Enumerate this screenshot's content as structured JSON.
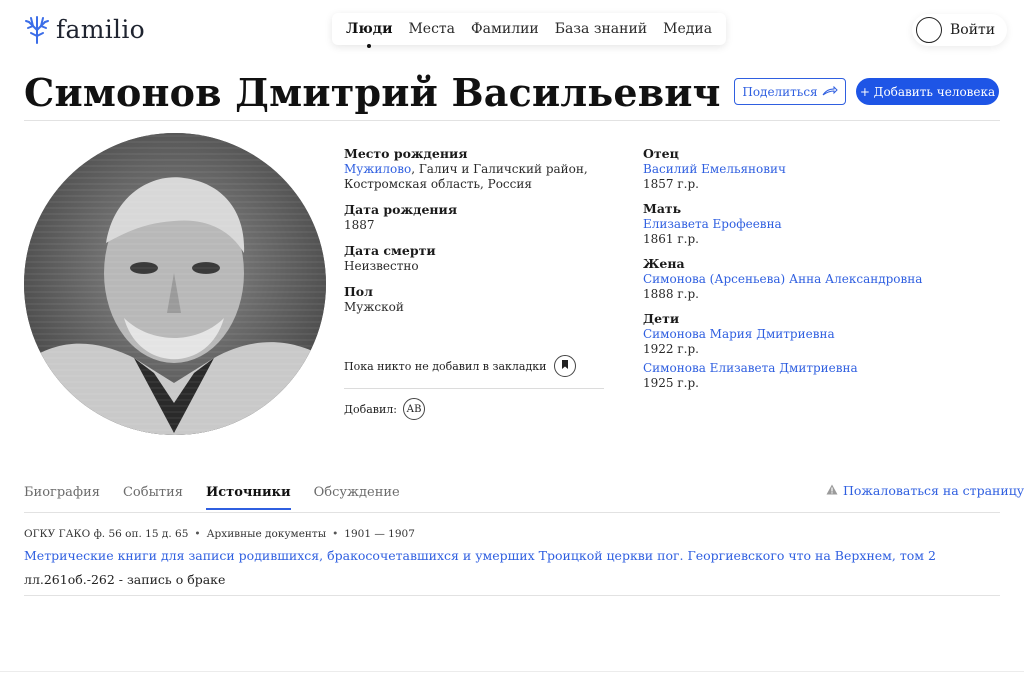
{
  "header": {
    "logo_text": "familio",
    "nav": [
      {
        "label": "Люди",
        "active": true
      },
      {
        "label": "Места"
      },
      {
        "label": "Фамилии"
      },
      {
        "label": "База знаний"
      },
      {
        "label": "Медиа"
      }
    ],
    "login_label": "Войти"
  },
  "person": {
    "name": "Симонов Дмитрий Васильевич",
    "share_label": "Поделиться",
    "add_label": "+ Добавить человека",
    "birth_place_label": "Место рождения",
    "birth_place_link": "Мужилово",
    "birth_place_rest": ", Галич и Галичский район, Костромская область, Россия",
    "birth_date_label": "Дата рождения",
    "birth_date": "1887",
    "death_date_label": "Дата смерти",
    "death_date": "Неизвестно",
    "gender_label": "Пол",
    "gender": "Мужской",
    "bookmarks_text": "Пока никто не добавил в закладки",
    "added_by_label": "Добавил:",
    "added_by_initials": "АВ"
  },
  "family": {
    "father_label": "Отец",
    "father_name": "Василий Емельянович",
    "father_year": "1857 г.р.",
    "mother_label": "Мать",
    "mother_name": "Елизавета Ерофеевна",
    "mother_year": "1861 г.р.",
    "wife_label": "Жена",
    "wife_name": "Симонова (Арсеньева) Анна Александровна",
    "wife_year": "1888 г.р.",
    "children_label": "Дети",
    "children": [
      {
        "name": "Симонова Мария Дмитриевна",
        "year": "1922 г.р."
      },
      {
        "name": "Симонова Елизавета Дмитриевна",
        "year": "1925 г.р."
      }
    ]
  },
  "tabs": [
    {
      "label": "Биография"
    },
    {
      "label": "События"
    },
    {
      "label": "Источники",
      "active": true
    },
    {
      "label": "Обсуждение"
    }
  ],
  "report_label": "Пожаловаться на страницу",
  "source": {
    "archive": "ОГКУ ГАКО ф. 56 оп. 15 д. 65",
    "type": "Архивные документы",
    "years": "1901 — 1907",
    "title": "Метрические книги для записи родившихся, бракосочетавшихся и умерших Троицкой церкви пог. Георгиевского что на Верхнем, том 2",
    "note": "лл.261об.-262 - запись о браке"
  },
  "colors": {
    "accent": "#2f5fe0",
    "button_primary": "#1e55e6",
    "logo_icon": "#3b6de8"
  },
  "icons": [
    "tree-logo-icon",
    "share-arrow-icon",
    "bookmark-icon",
    "warning-icon"
  ]
}
